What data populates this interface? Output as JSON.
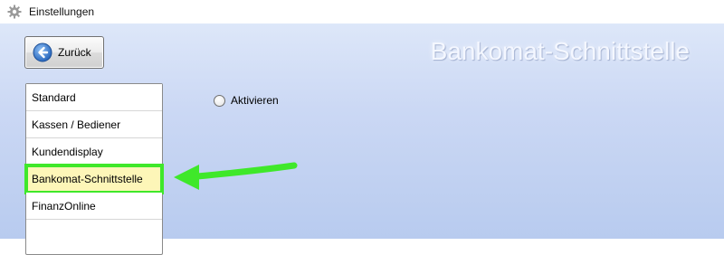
{
  "window": {
    "title": "Einstellungen",
    "icon": "gear-icon"
  },
  "toolbar": {
    "back_label": "Zurück",
    "back_icon": "arrow-left-circle-icon"
  },
  "page": {
    "title": "Bankomat-Schnittstelle"
  },
  "sidebar": {
    "items": [
      {
        "label": "Standard",
        "selected": false
      },
      {
        "label": "Kassen / Bediener",
        "selected": false
      },
      {
        "label": "Kundendisplay",
        "selected": false
      },
      {
        "label": "Bankomat-Schnittstelle",
        "selected": true
      },
      {
        "label": "FinanzOnline",
        "selected": false
      }
    ]
  },
  "settings": {
    "activate_label": "Aktivieren",
    "activate_checked": false
  },
  "colors": {
    "highlight_outline": "#3fe82a",
    "selected_background": "#fdf6b8",
    "annotation_arrow": "#3fe82a"
  }
}
